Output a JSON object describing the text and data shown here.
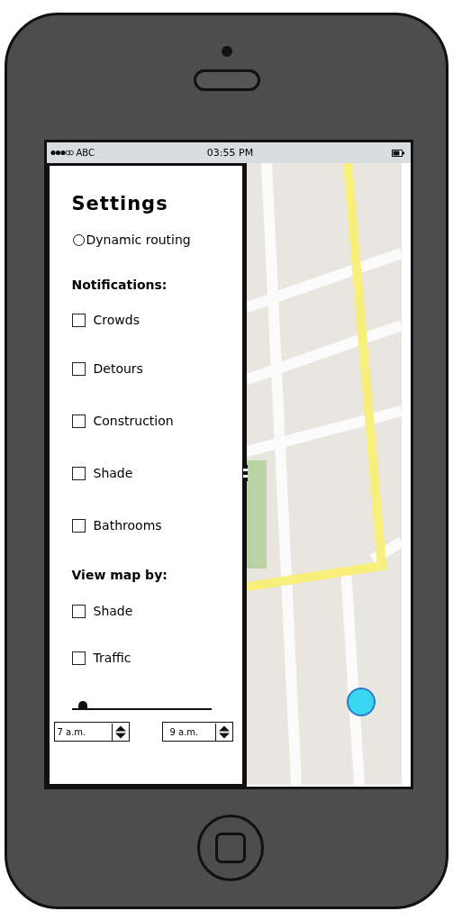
{
  "status_bar": {
    "carrier": "ABC",
    "time": "03:55 PM"
  },
  "settings": {
    "title": "Settings",
    "dynamic_routing": {
      "label": "Dynamic routing",
      "selected": false
    },
    "sections": [
      {
        "heading": "Notifications:",
        "options": [
          {
            "label": "Crowds",
            "checked": false
          },
          {
            "label": "Detours",
            "checked": false
          },
          {
            "label": "Construction",
            "checked": false
          },
          {
            "label": "Shade",
            "checked": false
          },
          {
            "label": "Bathrooms",
            "checked": false
          }
        ]
      },
      {
        "heading": "View map by:",
        "options": [
          {
            "label": "Shade",
            "checked": false
          },
          {
            "label": "Traffic",
            "checked": false
          }
        ]
      }
    ],
    "time_range": {
      "level": 0.08,
      "start": "7 a.m.",
      "end": "9 a.m."
    }
  }
}
